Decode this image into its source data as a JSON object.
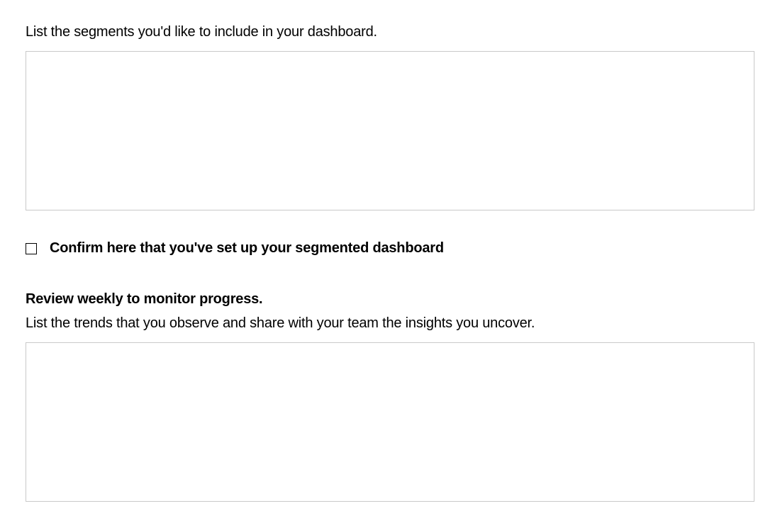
{
  "segments": {
    "prompt": "List the segments you'd like to include in your dashboard.",
    "value": ""
  },
  "confirm": {
    "label": "Confirm here that you've set up your segmented dashboard",
    "checked": false
  },
  "review": {
    "heading": "Review weekly to monitor progress.",
    "prompt": "List the trends that you observe and share with your team the insights you uncover.",
    "value": ""
  }
}
